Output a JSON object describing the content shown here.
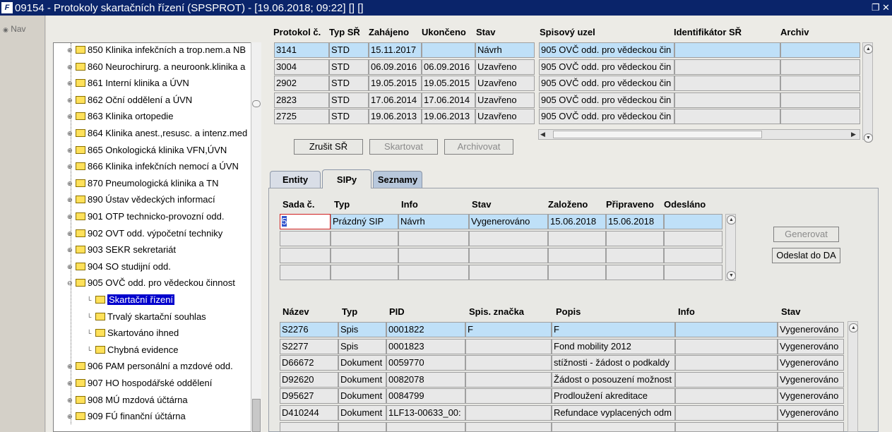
{
  "window": {
    "title": "09154 - Protokoly skartačních řízení (SPSPROT) - [19.06.2018; 09:22]  []  []",
    "app_icon": "F"
  },
  "nav": {
    "label": "Nav"
  },
  "tree": {
    "items": [
      {
        "label": "850 Klinika infekčních a trop.nem.a NB",
        "level": 0,
        "expander": "+"
      },
      {
        "label": "860 Neurochirurg. a neuroonk.klinika a",
        "level": 0,
        "expander": "+"
      },
      {
        "label": "861 Interní klinika a ÚVN",
        "level": 0,
        "expander": "+"
      },
      {
        "label": "862 Oční oddělení a ÚVN",
        "level": 0,
        "expander": "+"
      },
      {
        "label": "863 Klinika ortopedie",
        "level": 0,
        "expander": "+"
      },
      {
        "label": "864 Klinika anest.,resusc. a intenz.med",
        "level": 0,
        "expander": "+"
      },
      {
        "label": "865 Onkologická klinika VFN,ÚVN",
        "level": 0,
        "expander": "+"
      },
      {
        "label": "866 Klinika infekčních nemocí a ÚVN",
        "level": 0,
        "expander": "+"
      },
      {
        "label": "870 Pneumologická klinika a TN",
        "level": 0,
        "expander": "+"
      },
      {
        "label": "890 Ústav vědeckých informací",
        "level": 0,
        "expander": "+"
      },
      {
        "label": "901 OTP technicko-provozní odd.",
        "level": 0,
        "expander": "+"
      },
      {
        "label": "902 OVT odd. výpočetní techniky",
        "level": 0,
        "expander": "+"
      },
      {
        "label": "903 SEKR sekretariát",
        "level": 0,
        "expander": "+"
      },
      {
        "label": "904 SO studijní odd.",
        "level": 0,
        "expander": "+"
      },
      {
        "label": "905 OVČ odd. pro vědeckou činnost",
        "level": 0,
        "expander": "-"
      },
      {
        "label": "Skartační řízení",
        "level": 1,
        "expander": "",
        "selected": true
      },
      {
        "label": "Trvalý skartační souhlas",
        "level": 1,
        "expander": ""
      },
      {
        "label": "Skartováno ihned",
        "level": 1,
        "expander": ""
      },
      {
        "label": "Chybná evidence",
        "level": 1,
        "expander": ""
      },
      {
        "label": "906 PAM personální a mzdové odd.",
        "level": 0,
        "expander": "+"
      },
      {
        "label": "907 HO hospodářské oddělení",
        "level": 0,
        "expander": "+"
      },
      {
        "label": "908 MÚ mzdová účtárna",
        "level": 0,
        "expander": "+"
      },
      {
        "label": "909 FÚ finanční účtárna",
        "level": 0,
        "expander": "+"
      }
    ]
  },
  "protocols": {
    "headers": [
      "Protokol č.",
      "Typ SŘ",
      "Zahájeno",
      "Ukončeno",
      "Stav",
      "Spisový uzel",
      "Identifikátor SŘ",
      "Archiv"
    ],
    "rows": [
      [
        "3141",
        "STD",
        "15.11.2017",
        "",
        "Návrh",
        "905 OVČ odd. pro vědeckou čin",
        "",
        ""
      ],
      [
        "3004",
        "STD",
        "06.09.2016",
        "06.09.2016",
        "Uzavřeno",
        "905 OVČ odd. pro vědeckou čin",
        "",
        ""
      ],
      [
        "2902",
        "STD",
        "19.05.2015",
        "19.05.2015",
        "Uzavřeno",
        "905 OVČ odd. pro vědeckou čin",
        "",
        ""
      ],
      [
        "2823",
        "STD",
        "17.06.2014",
        "17.06.2014",
        "Uzavřeno",
        "905 OVČ odd. pro vědeckou čin",
        "",
        ""
      ],
      [
        "2725",
        "STD",
        "19.06.2013",
        "19.06.2013",
        "Uzavřeno",
        "905 OVČ odd. pro vědeckou čin",
        "",
        ""
      ]
    ]
  },
  "actions": {
    "zrusit": "Zrušit SŘ",
    "skartovat": "Skartovat",
    "archivovat": "Archivovat"
  },
  "tabs": [
    "Entity",
    "SIPy",
    "Seznamy"
  ],
  "active_tab": "SIPy",
  "sips": {
    "headers": [
      "Sada č.",
      "Typ",
      "Info",
      "Stav",
      "Založeno",
      "Připraveno",
      "Odesláno"
    ],
    "rows": [
      [
        "5",
        "Prázdný SIP",
        "Návrh",
        "Vygenerováno",
        "15.06.2018",
        "15.06.2018",
        ""
      ]
    ]
  },
  "sip_actions": {
    "generovat": "Generovat",
    "odeslat": "Odeslat do DA"
  },
  "entities": {
    "headers": [
      "Název",
      "Typ",
      "PID",
      "Spis. značka",
      "Popis",
      "Info",
      "Stav"
    ],
    "rows": [
      [
        "S2276",
        "Spis",
        "0001822",
        "F",
        "F",
        "",
        "Vygenerováno"
      ],
      [
        "S2277",
        "Spis",
        "0001823",
        "",
        "Fond mobility 2012",
        "",
        "Vygenerováno"
      ],
      [
        "D66672",
        "Dokument",
        "0059770",
        "",
        "stížnosti - žádost o podkaldy",
        "",
        "Vygenerováno"
      ],
      [
        "D92620",
        "Dokument",
        "0082078",
        "",
        "Žádost o posouzení možnost",
        "",
        "Vygenerováno"
      ],
      [
        "D95627",
        "Dokument",
        "0084799",
        "",
        "Prodloužení akreditace",
        "",
        "Vygenerováno"
      ],
      [
        "D410244",
        "Dokument",
        "1LF13-00633_00:",
        "",
        "Refundace vyplacených odm",
        "",
        "Vygenerováno"
      ]
    ]
  },
  "colors": {
    "titlebar": "#0a246a",
    "highlight_row": "#bfe0f8",
    "selection": "#0000cc"
  }
}
